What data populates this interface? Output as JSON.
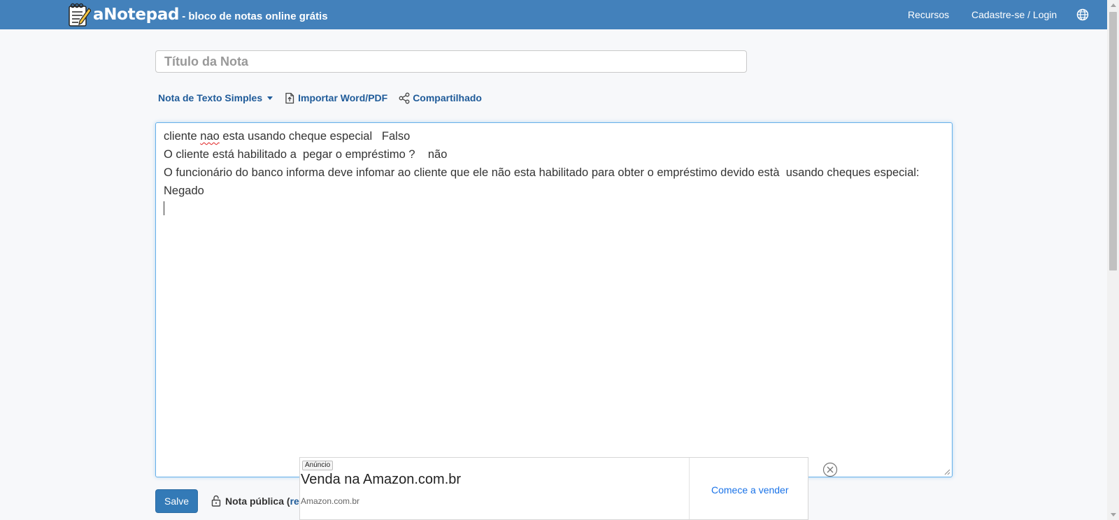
{
  "navbar": {
    "brand_name": "aNotepad",
    "brand_tagline": "- bloco de notas online grátis",
    "links": {
      "resources": "Recursos",
      "signup_login": "Cadastre-se / Login"
    },
    "language_icon": "globe-icon",
    "background_color": "#4381bb"
  },
  "note": {
    "title_placeholder": "Título da Nota",
    "title_value": ""
  },
  "toolbar": {
    "note_type": "Nota de Texto Simples",
    "import": "Importar Word/PDF",
    "share": "Compartilhado"
  },
  "editor": {
    "lines": [
      {
        "before": "cliente ",
        "spell": "nao",
        "after": " esta usando cheque especial   Falso"
      },
      "O cliente está habilitado a  pegar o empréstimo ?    não",
      "O funcionário do banco informa deve infomar ao cliente que ele não esta habilitado para obter o empréstimo devido està  usando cheques especial:     Negado"
    ]
  },
  "footer": {
    "save_label": "Salve",
    "public_note_label": "Nota pública (",
    "public_note_link": "re"
  },
  "ad": {
    "badge": "Anúncio",
    "headline": "Venda na Amazon.com.br",
    "domain": "Amazon.com.br",
    "cta": "Comece a vender"
  },
  "colors": {
    "link": "#1f5b99",
    "primary_button": "#337ab7",
    "editor_focus": "#66afe9"
  }
}
